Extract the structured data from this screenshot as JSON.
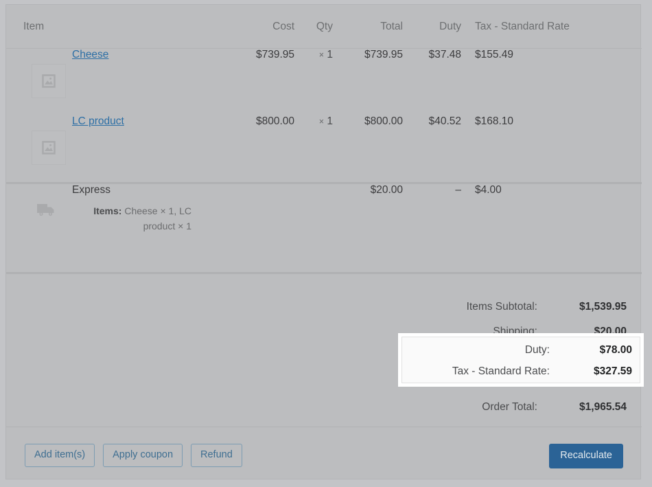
{
  "table": {
    "headers": {
      "item": "Item",
      "cost": "Cost",
      "qty": "Qty",
      "total": "Total",
      "duty": "Duty",
      "tax": "Tax - Standard Rate"
    },
    "items": [
      {
        "name": "Cheese",
        "thumb_icon": "image-placeholder-icon",
        "cost": "$739.95",
        "qty_symbol": "×",
        "qty": "1",
        "total": "$739.95",
        "duty": "$37.48",
        "tax": "$155.49"
      },
      {
        "name": "LC product",
        "thumb_icon": "image-placeholder-icon",
        "cost": "$800.00",
        "qty_symbol": "×",
        "qty": "1",
        "total": "$800.00",
        "duty": "$40.52",
        "tax": "$168.10"
      }
    ],
    "shipping": {
      "icon": "truck-icon",
      "name": "Express",
      "items_label": "Items:",
      "items_detail": "Cheese × 1, LC product × 1",
      "cost": "",
      "qty": "",
      "total": "$20.00",
      "duty": "–",
      "tax": "$4.00"
    }
  },
  "totals": {
    "rows": [
      {
        "label": "Items Subtotal:",
        "value": "$1,539.95",
        "highlighted": false
      },
      {
        "label": "Shipping:",
        "value": "$20.00",
        "highlighted": false
      },
      {
        "label": "Order Total:",
        "value": "$1,965.54",
        "highlighted": false
      }
    ],
    "highlighted_rows": [
      {
        "label": "Duty:",
        "value": "$78.00"
      },
      {
        "label": "Tax - Standard Rate:",
        "value": "$327.59"
      }
    ]
  },
  "actions": {
    "add_items": "Add item(s)",
    "apply_coupon": "Apply coupon",
    "refund": "Refund",
    "recalculate": "Recalculate"
  },
  "colors": {
    "link": "#2d6fa5",
    "primary_button": "#2b6396",
    "secondary_button_border": "#7c9cb2",
    "panel_background": "#bcbdbf",
    "highlight_background": "#ffffff"
  }
}
